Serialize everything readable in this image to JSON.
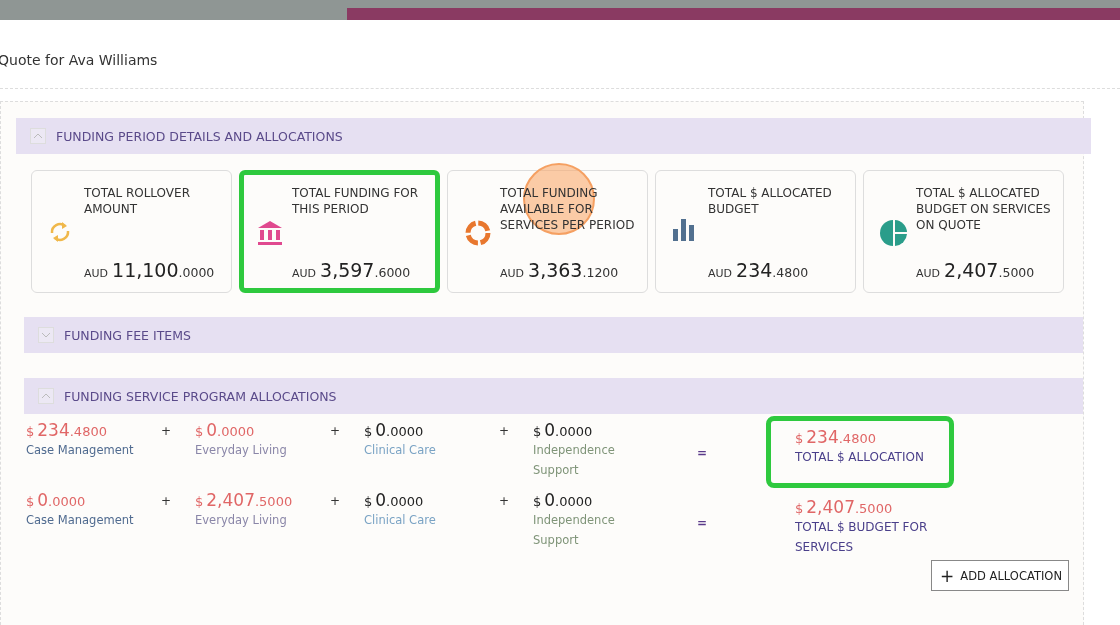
{
  "dialog": {
    "title": "Quote for Ava Williams"
  },
  "sections": [
    {
      "title": "FUNDING PERIOD DETAILS AND ALLOCATIONS",
      "expanded": true,
      "kind": "cards",
      "cards": [
        {
          "kind": "refresh",
          "color": "#f0b84a",
          "label": "TOTAL ROLLOVER AMOUNT",
          "currency": "AUD",
          "whole": "11,100",
          "decimals": ".0000",
          "highlighted": false
        },
        {
          "kind": "bank",
          "color": "#e0498f",
          "label": "TOTAL FUNDING FOR THIS PERIOD",
          "currency": "AUD",
          "whole": "3,597",
          "decimals": ".6000",
          "highlighted": true
        },
        {
          "kind": "ring",
          "color": "#e8772e",
          "label": "TOTAL FUNDING AVAILABLE FOR SERVICES PER PERIOD",
          "currency": "AUD",
          "whole": "3,363",
          "decimals": ".1200",
          "highlighted": false,
          "clicked": true
        },
        {
          "kind": "bars",
          "color": "#52708f",
          "label": "TOTAL $ ALLOCATED BUDGET",
          "currency": "AUD",
          "whole": "234",
          "decimals": ".4800",
          "highlighted": false
        },
        {
          "kind": "pie",
          "color": "#2a9d8a",
          "label": "TOTAL $ ALLOCATED BUDGET ON SERVICES ON QUOTE",
          "currency": "AUD",
          "whole": "2,407",
          "decimals": ".5000",
          "highlighted": false
        }
      ]
    },
    {
      "title": "FUNDING FEE ITEMS",
      "expanded": false,
      "kind": "plain"
    },
    {
      "title": "FUNDING SERVICE PROGRAM ALLOCATIONS",
      "expanded": true,
      "kind": "allocations",
      "rows": [
        {
          "terms": [
            {
              "symbol": "$",
              "whole": "234",
              "decimals": ".4800",
              "color": "#e06666",
              "label": "Case Management"
            },
            {
              "symbol": "$",
              "whole": "0",
              "decimals": ".0000",
              "color": "#e06666",
              "label": "Everyday Living"
            },
            {
              "symbol": "$",
              "whole": "0",
              "decimals": ".0000",
              "color": "#222222",
              "label": "Clinical Care"
            },
            {
              "symbol": "$",
              "whole": "0",
              "decimals": ".0000",
              "color": "#222222",
              "label": "Independence Support"
            }
          ],
          "plus": "+",
          "equals": "=",
          "total": {
            "symbol": "$",
            "whole": "234",
            "decimals": ".4800",
            "label": "TOTAL $ ALLOCATION",
            "highlighted": true
          }
        },
        {
          "terms": [
            {
              "symbol": "$",
              "whole": "0",
              "decimals": ".0000",
              "color": "#e06666",
              "label": "Case Management"
            },
            {
              "symbol": "$",
              "whole": "2,407",
              "decimals": ".5000",
              "color": "#e06666",
              "label": "Everyday Living"
            },
            {
              "symbol": "$",
              "whole": "0",
              "decimals": ".0000",
              "color": "#222222",
              "label": "Clinical Care"
            },
            {
              "symbol": "$",
              "whole": "0",
              "decimals": ".0000",
              "color": "#222222",
              "label": "Independence Support"
            }
          ],
          "plus": "+",
          "equals": "=",
          "total": {
            "symbol": "$",
            "whole": "2,407",
            "decimals": ".5000",
            "label": "TOTAL $ BUDGET FOR SERVICES",
            "highlighted": false
          }
        }
      ],
      "button": {
        "icon": "+",
        "label": "ADD ALLOCATION"
      }
    }
  ]
}
